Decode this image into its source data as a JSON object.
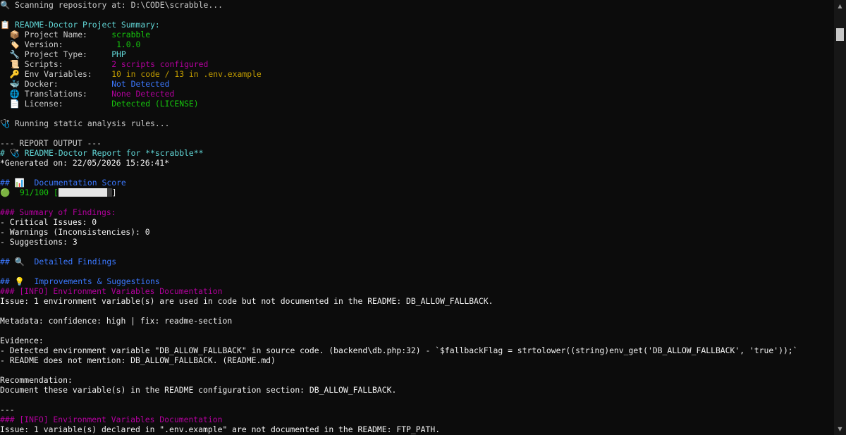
{
  "terminal": {
    "lines": [
      {
        "segments": [
          {
            "text": "🔍 Scanning repository at: D:\\CODE\\scrabble...",
            "color": "white"
          }
        ]
      },
      {
        "segments": []
      },
      {
        "segments": [
          {
            "text": "📋 README-Doctor Project Summary:",
            "color": "cyan"
          }
        ]
      },
      {
        "segments": [
          {
            "text": "  📦 Project Name:     ",
            "color": "white"
          },
          {
            "text": "scrabble",
            "color": "green"
          }
        ]
      },
      {
        "segments": [
          {
            "text": "  🏷️ Version:           ",
            "color": "white"
          },
          {
            "text": "1.0.0",
            "color": "green"
          }
        ]
      },
      {
        "segments": [
          {
            "text": "  🔧 Project Type:     ",
            "color": "white"
          },
          {
            "text": "PHP",
            "color": "cyan"
          }
        ]
      },
      {
        "segments": [
          {
            "text": "  📜 Scripts:          ",
            "color": "white"
          },
          {
            "text": "2 scripts configured",
            "color": "magenta"
          }
        ]
      },
      {
        "segments": [
          {
            "text": "  🔑 Env Variables:    ",
            "color": "white"
          },
          {
            "text": "10 in code / 13 in .env.example",
            "color": "yellow"
          }
        ]
      },
      {
        "segments": [
          {
            "text": "  🐳 Docker:           ",
            "color": "white"
          },
          {
            "text": "Not Detected",
            "color": "blue"
          }
        ]
      },
      {
        "segments": [
          {
            "text": "  🌐 Translations:     ",
            "color": "white"
          },
          {
            "text": "None Detected",
            "color": "magenta"
          }
        ]
      },
      {
        "segments": [
          {
            "text": "  📄 License:          ",
            "color": "white"
          },
          {
            "text": "Detected (LICENSE)",
            "color": "green"
          }
        ]
      },
      {
        "segments": []
      },
      {
        "segments": [
          {
            "text": "🩺 Running static analysis rules...",
            "color": "white"
          }
        ]
      },
      {
        "segments": []
      },
      {
        "segments": [
          {
            "text": "--- REPORT OUTPUT ---",
            "color": "white"
          }
        ]
      },
      {
        "segments": [
          {
            "text": "# 🩺 README-Doctor Report for **scrabble**",
            "color": "cyan"
          }
        ]
      },
      {
        "segments": [
          {
            "text": "*Generated on: 22/05/2026 15:26:41*",
            "color": "bright"
          }
        ]
      },
      {
        "segments": []
      },
      {
        "segments": [
          {
            "text": "## 📊  Documentation Score",
            "color": "blue"
          }
        ]
      },
      {
        "segments": [
          {
            "text": "🟢  91/100 [",
            "color": "green"
          },
          {
            "bar": true
          },
          {
            "text": "]",
            "color": "bright"
          }
        ]
      },
      {
        "segments": []
      },
      {
        "segments": [
          {
            "text": "### Summary of Findings:",
            "color": "magenta"
          }
        ]
      },
      {
        "segments": [
          {
            "text": "- Critical Issues: 0",
            "color": "bright"
          }
        ]
      },
      {
        "segments": [
          {
            "text": "- Warnings (Inconsistencies): 0",
            "color": "bright"
          }
        ]
      },
      {
        "segments": [
          {
            "text": "- Suggestions: 3",
            "color": "bright"
          }
        ]
      },
      {
        "segments": []
      },
      {
        "segments": [
          {
            "text": "## 🔍  Detailed Findings",
            "color": "blue"
          }
        ]
      },
      {
        "segments": []
      },
      {
        "segments": [
          {
            "text": "## 💡  Improvements & Suggestions",
            "color": "blue"
          }
        ]
      },
      {
        "segments": [
          {
            "text": "### [INFO] Environment Variables Documentation",
            "color": "magenta"
          }
        ]
      },
      {
        "segments": [
          {
            "text": "Issue: 1 environment variable(s) are used in code but not documented in the README: DB_ALLOW_FALLBACK.",
            "color": "bright"
          }
        ]
      },
      {
        "segments": []
      },
      {
        "segments": [
          {
            "text": "Metadata: confidence: high | fix: readme-section",
            "color": "bright"
          }
        ]
      },
      {
        "segments": []
      },
      {
        "segments": [
          {
            "text": "Evidence:",
            "color": "bright"
          }
        ]
      },
      {
        "segments": [
          {
            "text": "- Detected environment variable \"DB_ALLOW_FALLBACK\" in source code. (backend\\db.php:32) - `$fallbackFlag = strtolower((string)env_get('DB_ALLOW_FALLBACK', 'true'));`",
            "color": "bright"
          }
        ]
      },
      {
        "segments": [
          {
            "text": "- README does not mention: DB_ALLOW_FALLBACK. (README.md)",
            "color": "bright"
          }
        ]
      },
      {
        "segments": []
      },
      {
        "segments": [
          {
            "text": "Recommendation:",
            "color": "bright"
          }
        ]
      },
      {
        "segments": [
          {
            "text": "Document these variable(s) in the README configuration section: DB_ALLOW_FALLBACK.",
            "color": "bright"
          }
        ]
      },
      {
        "segments": []
      },
      {
        "segments": [
          {
            "text": "---",
            "color": "bright"
          }
        ]
      },
      {
        "segments": [
          {
            "text": "### [INFO] Environment Variables Documentation",
            "color": "magenta"
          }
        ]
      },
      {
        "segments": [
          {
            "text": "Issue: 1 variable(s) declared in \".env.example\" are not documented in the README: FTP_PATH.",
            "color": "bright"
          }
        ]
      }
    ],
    "score_bar": {
      "fraction": 0.91
    },
    "colors": {
      "white": "#cccccc",
      "bright": "#f2f2f2",
      "cyan": "#61d6d6",
      "green": "#16c60c",
      "yellow": "#c19c00",
      "magenta": "#b4009e",
      "blue": "#3b78ff"
    }
  },
  "scrollbar": {
    "up_icon": "▲",
    "down_icon": "▼"
  }
}
